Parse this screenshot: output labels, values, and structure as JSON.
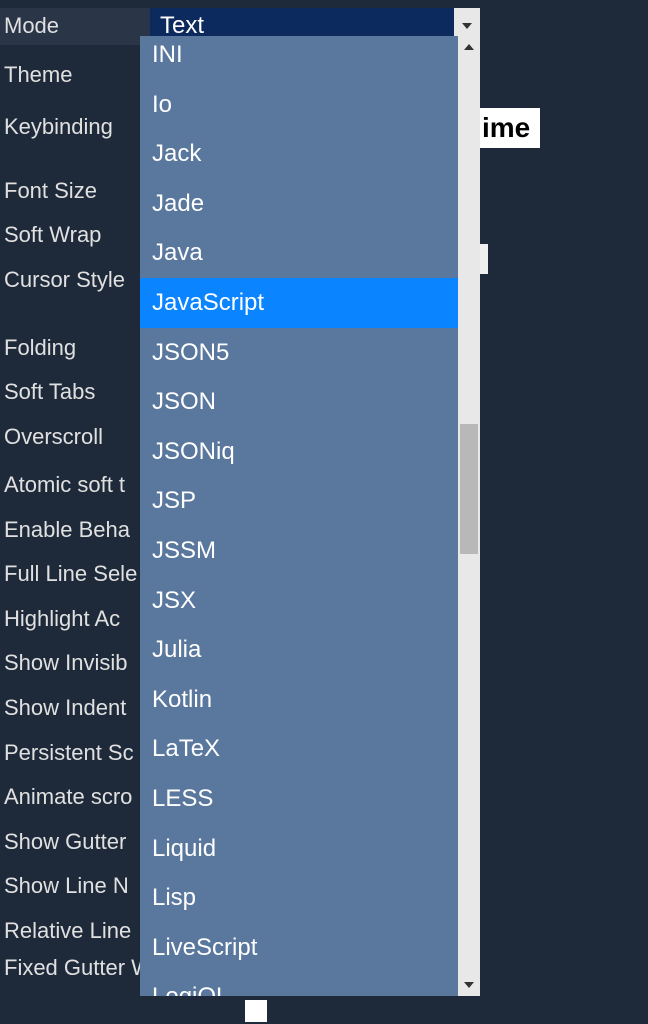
{
  "settings": {
    "labels": [
      "Mode",
      "Theme",
      "Keybinding",
      "Font Size",
      "Soft Wrap",
      "Cursor Style",
      "Folding",
      "Soft Tabs",
      "Overscroll",
      "Atomic soft t",
      "Enable Beha",
      "Full Line Sele",
      "Highlight Ac",
      "Show Invisib",
      "Show Indent",
      "Persistent Sc",
      "Animate scro",
      "Show Gutter",
      "Show Line N",
      "Relative Line",
      "Fixed Gutter Width"
    ]
  },
  "mode_select": {
    "current": "Text"
  },
  "dropdown": {
    "items": [
      "INI",
      "Io",
      "Jack",
      "Jade",
      "Java",
      "JavaScript",
      "JSON5",
      "JSON",
      "JSONiq",
      "JSP",
      "JSSM",
      "JSX",
      "Julia",
      "Kotlin",
      "LaTeX",
      "LESS",
      "Liquid",
      "Lisp",
      "LiveScript",
      "LogiQL"
    ],
    "highlighted_index": 5
  },
  "peek": {
    "right_text": "ime"
  }
}
